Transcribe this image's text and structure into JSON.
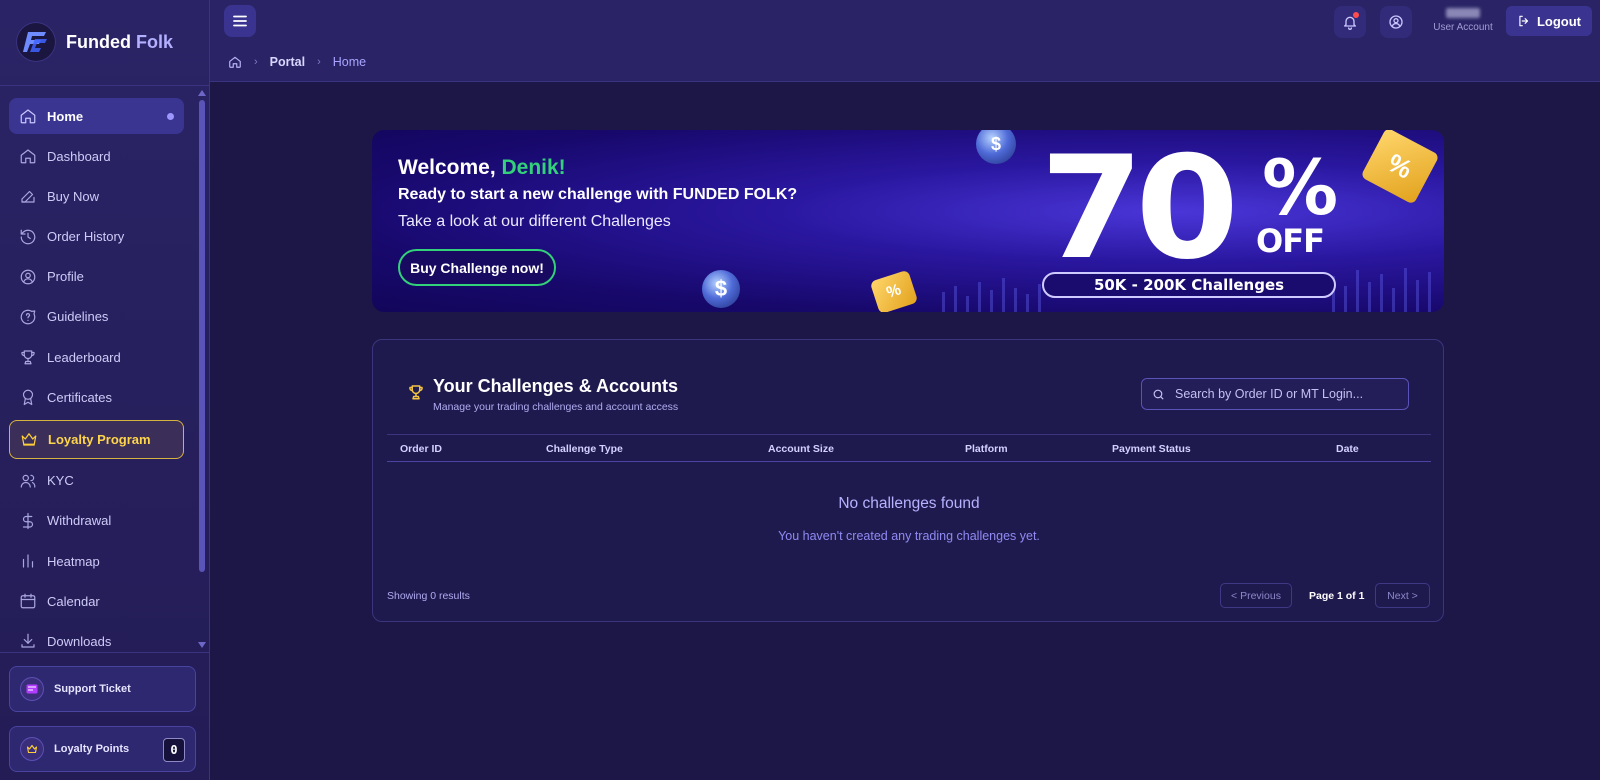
{
  "brand": {
    "name_primary": "Funded",
    "name_accent": "Folk"
  },
  "sidebar": {
    "items": [
      {
        "label": "Home",
        "icon": "home-icon"
      },
      {
        "label": "Dashboard",
        "icon": "home-icon"
      },
      {
        "label": "Buy Now",
        "icon": "edit-icon"
      },
      {
        "label": "Order History",
        "icon": "history-icon"
      },
      {
        "label": "Profile",
        "icon": "user-circle-icon"
      },
      {
        "label": "Guidelines",
        "icon": "help-bubble-icon"
      },
      {
        "label": "Leaderboard",
        "icon": "trophy-icon"
      },
      {
        "label": "Certificates",
        "icon": "award-icon"
      },
      {
        "label": "Loyalty Program",
        "icon": "crown-icon"
      },
      {
        "label": "KYC",
        "icon": "users-icon"
      },
      {
        "label": "Withdrawal",
        "icon": "dollar-icon"
      },
      {
        "label": "Heatmap",
        "icon": "bar-chart-icon"
      },
      {
        "label": "Calendar",
        "icon": "calendar-icon"
      },
      {
        "label": "Downloads",
        "icon": "download-icon"
      }
    ],
    "support_ticket": "Support Ticket",
    "loyalty_points": {
      "label": "Loyalty Points",
      "value": "0"
    }
  },
  "topbar": {
    "breadcrumb": [
      "Portal",
      "Home"
    ],
    "user_role": "User Account",
    "logout_label": "Logout"
  },
  "banner": {
    "welcome": "Welcome,",
    "user_name": "Denik!",
    "line1": "Ready to start a new challenge with FUNDED FOLK?",
    "line2": "Take a look at our different Challenges",
    "button": "Buy Challenge now!",
    "promo_number": "70",
    "promo_percent": "%",
    "promo_off": "OFF",
    "promo_range": "50K - 200K Challenges"
  },
  "challenges": {
    "title": "Your Challenges & Accounts",
    "subtitle": "Manage your trading challenges and account access",
    "search_placeholder": "Search by Order ID or MT Login...",
    "columns": [
      "Order ID",
      "Challenge Type",
      "Account Size",
      "Platform",
      "Payment Status",
      "Date"
    ],
    "empty_title": "No challenges found",
    "empty_subtitle": "You haven't created any trading challenges yet.",
    "showing": "Showing 0 results",
    "prev": "< Previous",
    "page": "Page 1 of 1",
    "next": "Next >"
  },
  "colors": {
    "accent_green": "#33d17a",
    "loyalty_gold": "#ffd54a",
    "background": "#1d1747"
  }
}
